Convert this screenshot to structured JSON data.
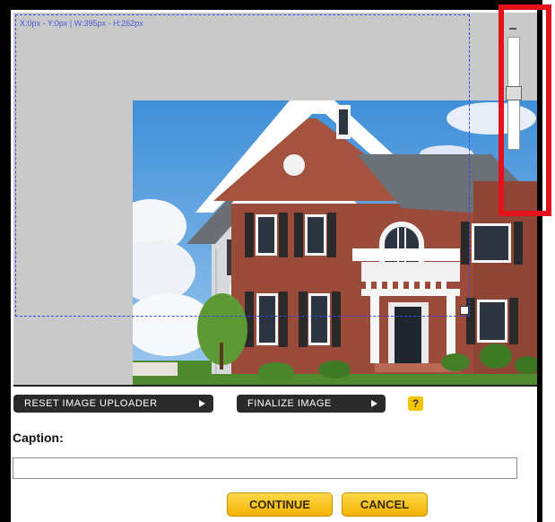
{
  "editor": {
    "crop_readout": "X:0px - Y:0px | W:395px - H:262px",
    "photo_subject": "brick-colonial-house-photo",
    "zoom": {
      "level_fraction": 0.5
    }
  },
  "actions": {
    "reset_label": "RESET IMAGE UPLOADER",
    "finalize_label": "FINALIZE IMAGE",
    "help_label": "?"
  },
  "caption": {
    "label": "Caption:",
    "value": "",
    "placeholder": ""
  },
  "footer": {
    "continue_label": "CONTINUE",
    "cancel_label": "CANCEL"
  },
  "colors": {
    "highlight": "#e5121b",
    "crop_guide": "#3c46e0",
    "button_yellow": "#f2b300",
    "button_dark": "#2a2a2a"
  }
}
